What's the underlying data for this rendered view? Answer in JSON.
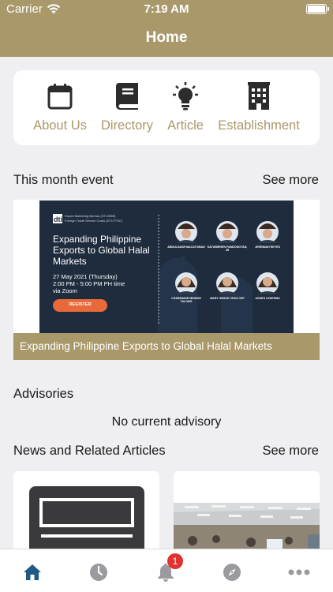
{
  "status_bar": {
    "carrier": "Carrier",
    "time": "7:19 AM"
  },
  "nav": {
    "title": "Home"
  },
  "quick_links": [
    {
      "label": "About Us",
      "icon": "calendar-icon"
    },
    {
      "label": "Directory",
      "icon": "book-icon"
    },
    {
      "label": "Article",
      "icon": "lightbulb-icon"
    },
    {
      "label": "Establishment",
      "icon": "building-icon"
    }
  ],
  "events": {
    "title": "This month event",
    "see_more": "See more",
    "featured": {
      "caption": "Expanding Philippine Exports to Global Halal Markets",
      "banner": {
        "org_line_1": "Export Marketing Bureau (DTI-EMB)",
        "org_line_2": "Foreign Trade Service Corps (DTI-FTSC)",
        "headline": "Expanding Philippine Exports to Global Halal Markets",
        "date": "27 May 2021 (Thursday)",
        "time": "2:00 PM - 5:00 PM PH time",
        "venue": "via Zoom",
        "register_label": "REGISTER",
        "speakers": [
          "ABDULNASR MACATOMAN",
          "SAYUBIRHEN PANDONOTAN, JR",
          "JEREMIAH REYES",
          "CHARMAINE MIGNON TALONG",
          "MARY GRACE CRUZ-YAP",
          "AGNES LEDESMA"
        ]
      }
    }
  },
  "advisories": {
    "title": "Advisories",
    "empty_message": "No current advisory"
  },
  "news": {
    "title": "News and Related Articles",
    "see_more": "See more"
  },
  "tabbar": {
    "tabs": [
      {
        "name": "home-icon",
        "active": true
      },
      {
        "name": "clock-icon",
        "active": false
      },
      {
        "name": "bell-icon",
        "active": false,
        "badge": "1"
      },
      {
        "name": "compass-icon",
        "active": false
      },
      {
        "name": "more-icon",
        "active": false
      }
    ]
  },
  "colors": {
    "accent": "#a8986a",
    "background": "#efeff2",
    "active_tab": "#1e5a85",
    "inactive_tab": "#9a9a9f",
    "badge": "#e0332f",
    "banner_bg": "#1f2c3d",
    "register_button": "#e86a3a"
  }
}
